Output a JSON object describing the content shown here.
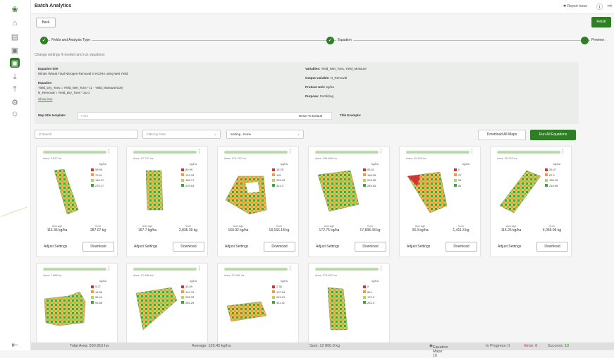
{
  "header": {
    "title": "Batch Analytics",
    "report_issue": "Report Issue"
  },
  "toolbar": {
    "back": "Back",
    "finish": "Finish"
  },
  "steps": [
    {
      "label": "Fields and Analysis Type",
      "state": "done"
    },
    {
      "label": "Equation",
      "state": "done"
    },
    {
      "label": "Preview",
      "state": "current"
    }
  ],
  "hint": "Change settings if needed and run equations",
  "equation": {
    "title_label": "Equation title",
    "title": "Winter Wheat Total Nitrogen Removal in KG/HA using Wet Yield",
    "eq_label": "Equation",
    "line1": "Yield_Dry_Tons = Yield_Wet_Tons * (1 - Yield_Moisture/100)",
    "line2": "N_Removal = Yield_Dry_Tons * 21.0",
    "show_less": "Show less",
    "variables_label": "Variables:",
    "variables": "Yield_Wet_Tons, Yield_Moisture",
    "output_label": "Output variable:",
    "output": "N_Removal",
    "product_label": "Product Unit:",
    "product": "kg/ha",
    "purpose_label": "Purpose:",
    "purpose": "Fertilizing",
    "map_title_label": "Map title template:",
    "map_title_placeholder": "Field",
    "reset": "Reset To Default",
    "title_example_label": "Title Example:"
  },
  "filters": {
    "search_placeholder": "Search",
    "filter_farm": "Filter by Farm",
    "sort": "Sorting - None",
    "download_all": "Download All Maps",
    "run_all": "Run All Equations"
  },
  "colors": {
    "accent": "#2f7d24",
    "c1": "#d6323a",
    "c2": "#f19a3e",
    "c3": "#bbd45a",
    "c4": "#39a84a"
  },
  "cards": [
    {
      "area": "Area: 3.837 ha",
      "unit": "kg/ha",
      "legend": [
        "59.66",
        "79.31",
        "146.07",
        "270.17"
      ],
      "avg_label": "Average",
      "avg": "116.35 kg/ha",
      "sum_label": "Sum",
      "sum": "287.07 kg",
      "adjust": "Adjust Settings",
      "download": "Download",
      "shape": "strip"
    },
    {
      "area": "Area: 12.797 ha",
      "unit": "kg/ha",
      "legend": [
        "80.99",
        "129.33",
        "186.71",
        "239.53"
      ],
      "avg_label": "Average",
      "avg": "167.7 kg/ha",
      "sum_label": "Sum",
      "sum": "2,836.39 kg",
      "adjust": "Adjust Settings",
      "download": "Download",
      "shape": "rect"
    },
    {
      "area": "Area: 174.797 ha",
      "unit": "kg/ha",
      "legend": [
        "18.25",
        "115",
        "253.15",
        "311.3"
      ],
      "avg_label": "Average",
      "avg": "160.92 kg/ha",
      "sum_label": "Sum",
      "sum": "18,166.18 kg",
      "adjust": "Adjust Settings",
      "download": "Download",
      "shape": "hole"
    },
    {
      "area": "Area: 105.849 ha",
      "unit": "kg/ha",
      "legend": [
        "83.61",
        "156.09",
        "226.95",
        "289.63"
      ],
      "avg_label": "Average",
      "avg": "172.75 kg/ha",
      "sum_label": "Sum",
      "sum": "17,838.43 kg",
      "adjust": "Adjust Settings",
      "download": "Download",
      "shape": "block"
    },
    {
      "area": "Area: 41.905 ha",
      "unit": "kg/ha",
      "legend": [
        "0",
        "27",
        "54",
        "81"
      ],
      "avg_label": "Average",
      "avg": "33.3 kg/ha",
      "sum_label": "Sum",
      "sum": "1,411.3 kg",
      "adjust": "Adjust Settings",
      "download": "Download",
      "shape": "tri"
    },
    {
      "area": "Area: 35.229 ha",
      "unit": "kg/ha",
      "legend": [
        "26.47",
        "87.2",
        "158.15",
        "218.96"
      ],
      "avg_label": "Average",
      "avg": "115.26 kg/ha",
      "sum_label": "Sum",
      "sum": "4,059.95 kg",
      "adjust": "Adjust Settings",
      "download": "Download",
      "shape": "para"
    },
    {
      "area": "Area: 7.888 ha",
      "unit": "kg/ha",
      "legend": [
        "5.27",
        "16.86",
        "33.44",
        "53.88"
      ],
      "shape": "blocky"
    },
    {
      "area": "Area: 21.388 ha",
      "unit": "kg/ha",
      "legend": [
        "33.59",
        "124.75",
        "225.33",
        "283.25"
      ],
      "shape": "diag"
    },
    {
      "area": "Area: 21.381 ha",
      "unit": "kg/ha",
      "legend": [
        "2.38",
        "107.54",
        "229.01",
        "311.31"
      ],
      "shape": "curve"
    },
    {
      "area": "Area: 173.817 ha",
      "unit": "kg/ha",
      "legend": [
        "0",
        "89.1",
        "170.3",
        "261.3"
      ],
      "shape": "tall"
    }
  ],
  "footer": {
    "total_area": "Total Area: 550.916 ha",
    "average": "Average: 129.45 kg/ha",
    "sum": "Sum: 12 860.9 kg",
    "eq_maps": "Equation Maps: 10",
    "in_progress": "In Progress: 0",
    "error": "Error: 0",
    "success": "Success: 10"
  }
}
